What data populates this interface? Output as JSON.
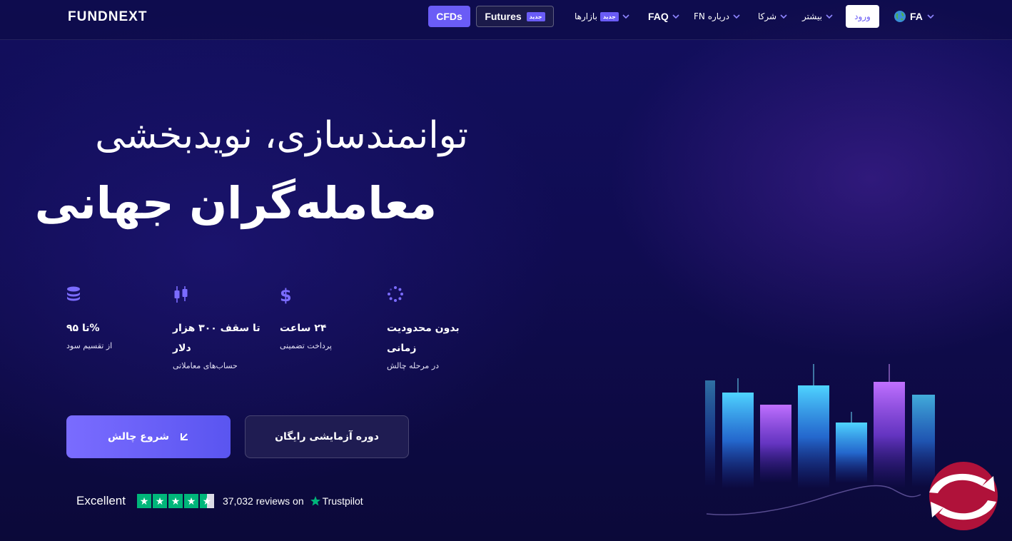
{
  "nav": {
    "logo": "FUNDNEXT",
    "tabs": [
      {
        "label": "CFDs",
        "active": true
      },
      {
        "label": "Futures",
        "badge": "جدید"
      }
    ],
    "items": [
      {
        "label": "بازارها",
        "badge": "جدید",
        "icon": "chevron-down-icon"
      },
      {
        "label": "FAQ",
        "icon": "chevron-down-icon"
      },
      {
        "label": "FN درباره",
        "icon": "chevron-down-icon"
      },
      {
        "label": "شرکا",
        "icon": "chevron-down-icon"
      },
      {
        "label": "بیشتر",
        "icon": "chevron-down-icon"
      }
    ],
    "login": "ورود",
    "language": {
      "label": "FA",
      "icon": "globe-icon"
    }
  },
  "hero": {
    "line1": "توانمندسازی، نویدبخشی",
    "line2": "معامله‌گران جهانی"
  },
  "features": [
    {
      "icon": "coins-stack-icon",
      "title": "%تا ۹۵",
      "desc": "از تقسیم سود"
    },
    {
      "icon": "candlestick-icon",
      "title": "تا سقف ۳۰۰ هزار دلار",
      "desc": "حساب‌های معاملاتی"
    },
    {
      "icon": "dollar-icon",
      "title": "۲۴ ساعت",
      "desc": "پرداخت تضمینی"
    },
    {
      "icon": "loading-circle-icon",
      "title": "بدون محدودیت زمانی",
      "desc": "در مرحله چالش"
    }
  ],
  "cta": {
    "primary": "شروع چالش",
    "primary_icon": "arrow-icon",
    "secondary": "دوره آزمایشی رایگان"
  },
  "trustpilot": {
    "rating_text": "Excellent",
    "stars": 4.5,
    "reviews": "37,032 reviews on",
    "brand": "Trustpilot"
  },
  "colors": {
    "accent": "#6a5cf6",
    "trustpilot_green": "#00b67a",
    "background": "#120f5e"
  }
}
